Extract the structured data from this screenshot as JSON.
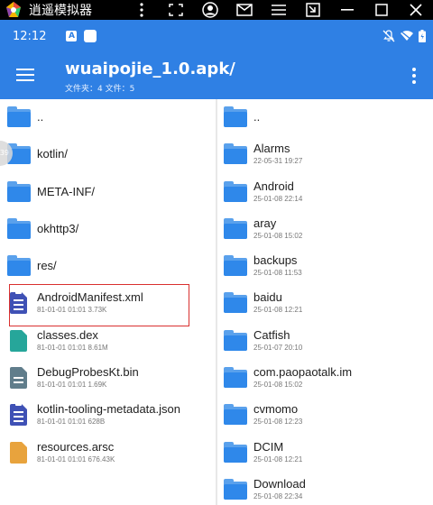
{
  "emulator": {
    "title": "逍遥模拟器",
    "icons": [
      "more-vertical-icon",
      "screenshot-frame-icon",
      "account-icon",
      "mail-icon",
      "menu-lines-icon",
      "fullscreen-exit-icon",
      "minimize-icon",
      "maximize-icon",
      "close-icon"
    ]
  },
  "status": {
    "time": "12:12",
    "a_label": "A",
    "icons": [
      "mute-icon",
      "wifi-icon",
      "battery-icon"
    ]
  },
  "app_bar": {
    "title": "wuaipojie_1.0.apk/",
    "subtitle": "文件夹：4  文件：5"
  },
  "left_pane": [
    {
      "name": "..",
      "meta": "",
      "icon": "folder-icon"
    },
    {
      "name": "kotlin/",
      "meta": "",
      "icon": "folder-icon"
    },
    {
      "name": "META-INF/",
      "meta": "",
      "icon": "folder-icon"
    },
    {
      "name": "okhttp3/",
      "meta": "",
      "icon": "folder-icon"
    },
    {
      "name": "res/",
      "meta": "",
      "icon": "folder-icon"
    },
    {
      "name": "AndroidManifest.xml",
      "meta": "81-01-01 01:01  3.73K",
      "icon": "xml-file-icon"
    },
    {
      "name": "classes.dex",
      "meta": "81-01-01 01:01  8.61M",
      "icon": "dex-file-icon"
    },
    {
      "name": "DebugProbesKt.bin",
      "meta": "81-01-01 01:01  1.69K",
      "icon": "bin-file-icon"
    },
    {
      "name": "kotlin-tooling-metadata.json",
      "meta": "81-01-01 01:01  628B",
      "icon": "json-file-icon"
    },
    {
      "name": "resources.arsc",
      "meta": "81-01-01 01:01  676.43K",
      "icon": "arsc-file-icon"
    }
  ],
  "right_pane": [
    {
      "name": "..",
      "meta": ""
    },
    {
      "name": "Alarms",
      "meta": "22-05-31 19:27"
    },
    {
      "name": "Android",
      "meta": "25-01-08 22:14"
    },
    {
      "name": "aray",
      "meta": "25-01-08 15:02"
    },
    {
      "name": "backups",
      "meta": "25-01-08 11:53"
    },
    {
      "name": "baidu",
      "meta": "25-01-08 12:21"
    },
    {
      "name": "Catfish",
      "meta": "25-01-07 20:10"
    },
    {
      "name": "com.paopaotalk.im",
      "meta": "25-01-08 15:02"
    },
    {
      "name": "cvmomo",
      "meta": "25-01-08 12:23"
    },
    {
      "name": "DCIM",
      "meta": "25-01-08 12:21"
    },
    {
      "name": "Download",
      "meta": "25-01-08 22:34"
    }
  ],
  "colors": {
    "primary": "#2f80e4",
    "folder": "#2f88ea",
    "xml": "#3f51b5",
    "dex": "#26a69a",
    "bin": "#607d8b",
    "json": "#3f51b5",
    "arsc": "#e8a33d",
    "highlight": "#d9302f"
  },
  "side_bubble": "39"
}
